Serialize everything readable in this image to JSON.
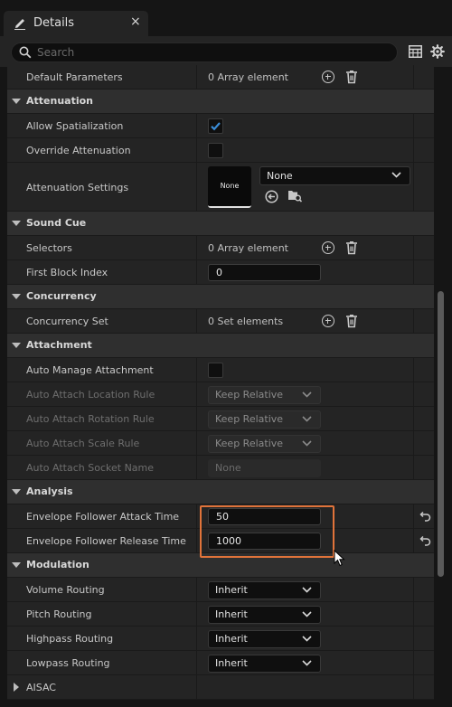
{
  "tab": {
    "title": "Details",
    "close": "×"
  },
  "search": {
    "placeholder": "Search"
  },
  "rows": {
    "default_parameters": {
      "label": "Default Parameters",
      "value": "0 Array element"
    },
    "attenuation": {
      "label": "Attenuation"
    },
    "allow_spatialization": {
      "label": "Allow Spatialization",
      "checked": true
    },
    "override_attenuation": {
      "label": "Override Attenuation",
      "checked": false
    },
    "attenuation_settings": {
      "label": "Attenuation Settings",
      "thumb": "None",
      "asset": "None"
    },
    "sound_cue": {
      "label": "Sound Cue"
    },
    "selectors": {
      "label": "Selectors",
      "value": "0 Array element"
    },
    "first_block_index": {
      "label": "First Block Index",
      "value": "0"
    },
    "concurrency": {
      "label": "Concurrency"
    },
    "concurrency_set": {
      "label": "Concurrency Set",
      "value": "0 Set elements"
    },
    "attachment": {
      "label": "Attachment"
    },
    "auto_manage_attachment": {
      "label": "Auto Manage Attachment",
      "checked": false
    },
    "auto_attach_location_rule": {
      "label": "Auto Attach Location Rule",
      "value": "Keep Relative"
    },
    "auto_attach_rotation_rule": {
      "label": "Auto Attach Rotation Rule",
      "value": "Keep Relative"
    },
    "auto_attach_scale_rule": {
      "label": "Auto Attach Scale Rule",
      "value": "Keep Relative"
    },
    "auto_attach_socket_name": {
      "label": "Auto Attach Socket Name",
      "value": "None"
    },
    "analysis": {
      "label": "Analysis"
    },
    "envelope_attack": {
      "label": "Envelope Follower Attack Time",
      "value": "50"
    },
    "envelope_release": {
      "label": "Envelope Follower Release Time",
      "value": "1000"
    },
    "modulation": {
      "label": "Modulation"
    },
    "volume_routing": {
      "label": "Volume Routing",
      "value": "Inherit"
    },
    "pitch_routing": {
      "label": "Pitch Routing",
      "value": "Inherit"
    },
    "highpass_routing": {
      "label": "Highpass Routing",
      "value": "Inherit"
    },
    "lowpass_routing": {
      "label": "Lowpass Routing",
      "value": "Inherit"
    },
    "aisac": {
      "label": "AISAC"
    }
  },
  "colors": {
    "highlight": "#e0733a",
    "accent": "#3a8cd6"
  }
}
